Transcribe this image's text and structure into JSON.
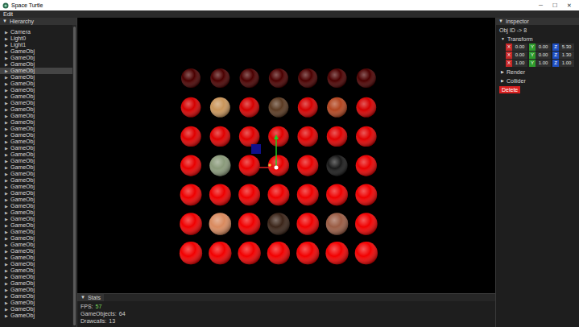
{
  "window": {
    "title": "Space Turtle",
    "controls": [
      "─",
      "☐",
      "✕"
    ]
  },
  "menu": [
    {
      "label": "Edit"
    }
  ],
  "hierarchy": {
    "title": "Hierarchy",
    "toggle": "▼",
    "items": [
      {
        "label": "Camera",
        "arrow": "▶",
        "selected": false
      },
      {
        "label": "Light0",
        "arrow": "▶",
        "selected": false
      },
      {
        "label": "Light1",
        "arrow": "▶",
        "selected": false
      },
      {
        "label": "GameObj",
        "arrow": "▶",
        "selected": false
      },
      {
        "label": "GameObj",
        "arrow": "▶",
        "selected": false
      },
      {
        "label": "GameObj",
        "arrow": "▶",
        "selected": false
      },
      {
        "label": "GameObj",
        "arrow": "▶",
        "selected": true
      },
      {
        "label": "GameObj",
        "arrow": "▶",
        "selected": false
      },
      {
        "label": "GameObj",
        "arrow": "▶",
        "selected": false
      },
      {
        "label": "GameObj",
        "arrow": "▶",
        "selected": false
      },
      {
        "label": "GameObj",
        "arrow": "▶",
        "selected": false
      },
      {
        "label": "GameObj",
        "arrow": "▶",
        "selected": false
      },
      {
        "label": "GameObj",
        "arrow": "▶",
        "selected": false
      },
      {
        "label": "GameObj",
        "arrow": "▶",
        "selected": false
      },
      {
        "label": "GameObj",
        "arrow": "▶",
        "selected": false
      },
      {
        "label": "GameObj",
        "arrow": "▶",
        "selected": false
      },
      {
        "label": "GameObj",
        "arrow": "▶",
        "selected": false
      },
      {
        "label": "GameObj",
        "arrow": "▶",
        "selected": false
      },
      {
        "label": "GameObj",
        "arrow": "▶",
        "selected": false
      },
      {
        "label": "GameObj",
        "arrow": "▶",
        "selected": false
      },
      {
        "label": "GameObj",
        "arrow": "▶",
        "selected": false
      },
      {
        "label": "GameObj",
        "arrow": "▶",
        "selected": false
      },
      {
        "label": "GameObj",
        "arrow": "▶",
        "selected": false
      },
      {
        "label": "GameObj",
        "arrow": "▶",
        "selected": false
      },
      {
        "label": "GameObj",
        "arrow": "▶",
        "selected": false
      },
      {
        "label": "GameObj",
        "arrow": "▶",
        "selected": false
      },
      {
        "label": "GameObj",
        "arrow": "▶",
        "selected": false
      },
      {
        "label": "GameObj",
        "arrow": "▶",
        "selected": false
      },
      {
        "label": "GameObj",
        "arrow": "▶",
        "selected": false
      },
      {
        "label": "GameObj",
        "arrow": "▶",
        "selected": false
      },
      {
        "label": "GameObj",
        "arrow": "▶",
        "selected": false
      },
      {
        "label": "GameObj",
        "arrow": "▶",
        "selected": false
      },
      {
        "label": "GameObj",
        "arrow": "▶",
        "selected": false
      },
      {
        "label": "GameObj",
        "arrow": "▶",
        "selected": false
      },
      {
        "label": "GameObj",
        "arrow": "▶",
        "selected": false
      },
      {
        "label": "GameObj",
        "arrow": "▶",
        "selected": false
      },
      {
        "label": "GameObj",
        "arrow": "▶",
        "selected": false
      },
      {
        "label": "GameObj",
        "arrow": "▶",
        "selected": false
      },
      {
        "label": "GameObj",
        "arrow": "▶",
        "selected": false
      },
      {
        "label": "GameObj",
        "arrow": "▶",
        "selected": false
      },
      {
        "label": "GameObj",
        "arrow": "▶",
        "selected": false
      },
      {
        "label": "GameObj",
        "arrow": "▶",
        "selected": false
      },
      {
        "label": "GameObj",
        "arrow": "▶",
        "selected": false
      },
      {
        "label": "GameObj",
        "arrow": "▶",
        "selected": false
      },
      {
        "label": "GameObj",
        "arrow": "▶",
        "selected": false
      }
    ]
  },
  "viewport": {
    "spheres": [
      [
        {
          "color": "#4a0000"
        },
        {
          "color": "#4a0000"
        },
        {
          "color": "#4a0000"
        },
        {
          "color": "#4a0000"
        },
        {
          "color": "#4a0000"
        },
        {
          "color": "#4a0000"
        },
        {
          "color": "#4a0000"
        }
      ],
      [
        {
          "color": "#d40000"
        },
        {
          "color": "#c9955a"
        },
        {
          "color": "#d40000"
        },
        {
          "color": "#5a3a22"
        },
        {
          "color": "#d40000"
        },
        {
          "color": "#b2451f"
        },
        {
          "color": "#d40000"
        }
      ],
      [
        {
          "color": "#e00000"
        },
        {
          "color": "#e00000"
        },
        {
          "color": "#e00000"
        },
        {
          "color": "#e00000"
        },
        {
          "color": "#e00000"
        },
        {
          "color": "#e00000"
        },
        {
          "color": "#e00000"
        }
      ],
      [
        {
          "color": "#e80000"
        },
        {
          "color": "#8a9a7a"
        },
        {
          "color": "#e80000"
        },
        {
          "color": "#e80000"
        },
        {
          "color": "#e80000"
        },
        {
          "color": "#1a1a1a"
        },
        {
          "color": "#e80000"
        }
      ],
      [
        {
          "color": "#ee0000"
        },
        {
          "color": "#ee0000"
        },
        {
          "color": "#ee0000"
        },
        {
          "color": "#ee0000"
        },
        {
          "color": "#ee0000"
        },
        {
          "color": "#ee0000"
        },
        {
          "color": "#ee0000"
        }
      ],
      [
        {
          "color": "#f00000"
        },
        {
          "color": "#d98a5e"
        },
        {
          "color": "#f00000"
        },
        {
          "color": "#3a2418"
        },
        {
          "color": "#f00000"
        },
        {
          "color": "#9a5c44"
        },
        {
          "color": "#f00000"
        }
      ],
      [
        {
          "color": "#f20000"
        },
        {
          "color": "#f20000"
        },
        {
          "color": "#f20000"
        },
        {
          "color": "#f20000"
        },
        {
          "color": "#f20000"
        },
        {
          "color": "#f20000"
        },
        {
          "color": "#f20000"
        }
      ]
    ]
  },
  "inspector": {
    "title": "Inspector",
    "toggle": "▼",
    "object_id": "Obj ID -> 8",
    "sections": [
      {
        "label": "Transform",
        "arrow": "▼",
        "expanded": true,
        "rows": [
          [
            {
              "axis": "X",
              "value": "0.00",
              "color": "#c62828"
            },
            {
              "axis": "Y",
              "value": "0.00",
              "color": "#2e9b2e"
            },
            {
              "axis": "Z",
              "value": "5.30",
              "color": "#1e4fc2"
            }
          ],
          [
            {
              "axis": "X",
              "value": "0.00",
              "color": "#c62828"
            },
            {
              "axis": "Y",
              "value": "0.00",
              "color": "#2e9b2e"
            },
            {
              "axis": "Z",
              "value": "1.30",
              "color": "#1e4fc2"
            }
          ],
          [
            {
              "axis": "X",
              "value": "1.00",
              "color": "#c62828"
            },
            {
              "axis": "Y",
              "value": "1.00",
              "color": "#2e9b2e"
            },
            {
              "axis": "Z",
              "value": "1.00",
              "color": "#1e4fc2"
            }
          ]
        ]
      },
      {
        "label": "Render",
        "arrow": "▶",
        "expanded": false,
        "rows": []
      },
      {
        "label": "Collider",
        "arrow": "▶",
        "expanded": false,
        "rows": []
      }
    ],
    "delete_button": "Delete"
  },
  "stats": {
    "title": "Stats",
    "toggle": "▼",
    "lines": [
      {
        "label": "FPS:",
        "value": "57",
        "color": "#7cd85a"
      },
      {
        "label": "GameObjects:",
        "value": "64",
        "color": "#d0d0d0"
      },
      {
        "label": "Drawcalls:",
        "value": "13",
        "color": "#d0d0d0"
      }
    ]
  }
}
